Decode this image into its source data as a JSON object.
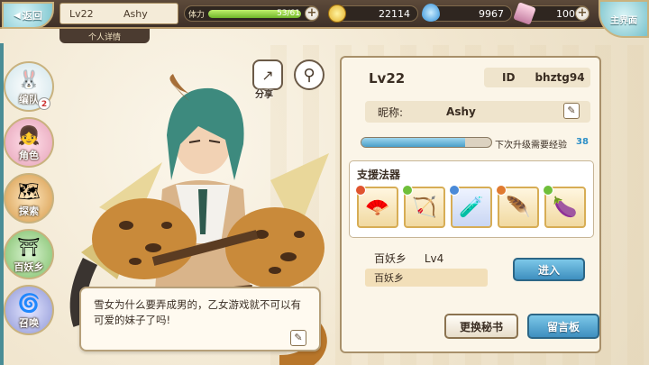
{
  "topbar": {
    "back_label": "返回",
    "player_level": "Lv22",
    "player_name": "Ashy",
    "detail_tab": "个人详情",
    "stamina_label": "体力",
    "stamina_value": "53/61",
    "stamina_fraction": 0.869,
    "coins": "22114",
    "gems": "9967",
    "tickets": "1001",
    "main_label": "主界面"
  },
  "sidenav": {
    "items": [
      {
        "label": "编队",
        "icon": "team-icon",
        "badge": "2"
      },
      {
        "label": "角色",
        "icon": "character-icon"
      },
      {
        "label": "探索",
        "icon": "explore-icon"
      },
      {
        "label": "百妖乡",
        "icon": "village-icon"
      },
      {
        "label": "召唤",
        "icon": "summon-icon"
      }
    ]
  },
  "actions": {
    "share_label": "分享"
  },
  "dialogue": {
    "text": "雪女为什么要弄成男的，乙女游戏就不可以有可爱的妹子了吗!"
  },
  "profile": {
    "level": "Lv22",
    "id_label": "ID",
    "id_value": "bhztg94",
    "nickname_label": "昵称:",
    "nickname_value": "Ashy",
    "exp_label": "下次升级需要经验",
    "exp_value": "38",
    "exp_fraction": 0.8
  },
  "support": {
    "title": "支援法器",
    "items": [
      {
        "name": "fan-icon",
        "gem_color": "#e0542f"
      },
      {
        "name": "crossbow-icon",
        "gem_color": "#6fbf3a"
      },
      {
        "name": "potion-icon",
        "gem_color": "#4a8ad8"
      },
      {
        "name": "feathers-icon",
        "gem_color": "#e07a2f"
      },
      {
        "name": "eggplant-icon",
        "gem_color": "#6fbf3a"
      }
    ]
  },
  "village": {
    "name": "百妖乡",
    "level": "Lv4",
    "field_value": "百妖乡",
    "enter_label": "进入"
  },
  "buttons": {
    "change_secretary": "更换秘书",
    "message_board": "留言板"
  }
}
